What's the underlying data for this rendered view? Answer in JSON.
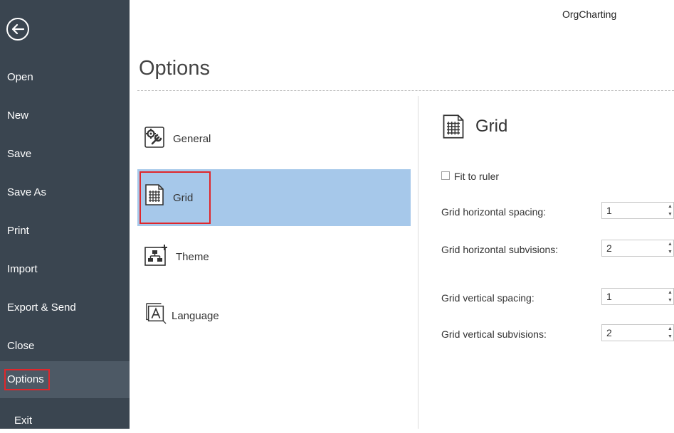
{
  "app": {
    "title": "OrgCharting"
  },
  "sidebar": {
    "items": [
      {
        "label": "Open"
      },
      {
        "label": "New"
      },
      {
        "label": "Save"
      },
      {
        "label": "Save As"
      },
      {
        "label": "Print"
      },
      {
        "label": "Import"
      },
      {
        "label": "Export & Send"
      },
      {
        "label": "Close"
      },
      {
        "label": "Options",
        "active": true
      },
      {
        "label": "Exit"
      }
    ]
  },
  "page": {
    "title": "Options"
  },
  "categories": [
    {
      "label": "General",
      "icon": "gear-wrench-icon"
    },
    {
      "label": "Grid",
      "icon": "grid-icon",
      "selected": true
    },
    {
      "label": "Theme",
      "icon": "theme-icon"
    },
    {
      "label": "Language",
      "icon": "language-icon"
    }
  ],
  "panel": {
    "title": "Grid",
    "fit_to_ruler": {
      "label": "Fit to ruler",
      "checked": false
    },
    "fields": [
      {
        "label": "Grid horizontal spacing:",
        "value": "1"
      },
      {
        "label": "Grid horizontal subvisions:",
        "value": "2"
      },
      {
        "label": "Grid vertical spacing:",
        "value": "1"
      },
      {
        "label": "Grid vertical subvisions:",
        "value": "2"
      }
    ]
  },
  "colors": {
    "sidebar_bg": "#3a4550",
    "selected_bg": "#a6c8ea",
    "highlight": "#e0262b"
  }
}
